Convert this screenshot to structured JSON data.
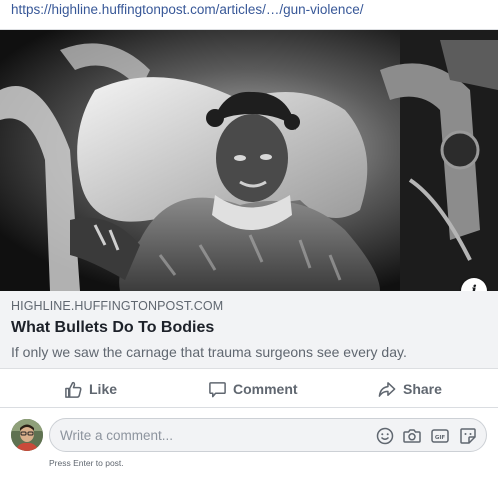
{
  "post": {
    "link_text": "https://highline.huffingtonpost.com/articles/…/gun-violence/"
  },
  "link_preview": {
    "image_description_icon": "photo",
    "info_icon": "info-icon",
    "info_label": "i",
    "domain": "HIGHLINE.HUFFINGTONPOST.COM",
    "title": "What Bullets Do To Bodies",
    "description": "If only we saw the carnage that trauma surgeons see every day."
  },
  "actions": {
    "like_label": "Like",
    "comment_label": "Comment",
    "share_label": "Share",
    "icon_color": "#606770"
  },
  "comment": {
    "placeholder": "Write a comment...",
    "hint": "Press Enter to post.",
    "icons": [
      "emoji-icon",
      "camera-icon",
      "gif-icon",
      "sticker-icon"
    ]
  },
  "colors": {
    "link": "#385898",
    "card_background": "#f2f3f5",
    "secondary_text": "#606770"
  }
}
